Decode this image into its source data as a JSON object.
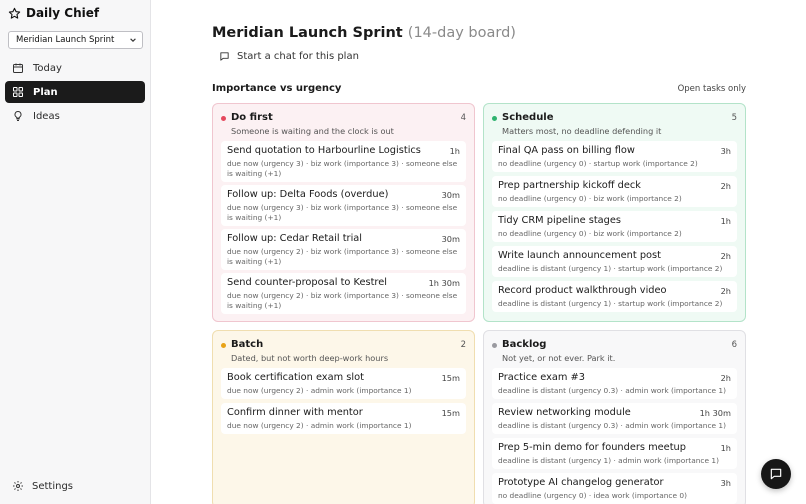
{
  "app": {
    "title": "Daily Chief",
    "accent": "#1b1b1b"
  },
  "board_select": {
    "value": "Meridian Launch Sprint"
  },
  "nav": [
    {
      "label": "Today",
      "icon": "calendar-icon",
      "active": false
    },
    {
      "label": "Plan",
      "icon": "grid-icon",
      "active": true
    },
    {
      "label": "Ideas",
      "icon": "lightbulb-icon",
      "active": false
    }
  ],
  "settings_label": "Settings",
  "header": {
    "title": "Meridian Launch Sprint",
    "subtitle": "(14-day board)",
    "chat_link": "Start a chat for this plan"
  },
  "matrix": {
    "title": "Importance vs urgency",
    "filter": "Open tasks only",
    "quadrants": {
      "do_first": {
        "name": "Do first",
        "count": "4",
        "desc": "Someone is waiting and the clock is out",
        "color": "#e5485d",
        "tasks": [
          {
            "title": "Send quotation to Harbourline Logistics",
            "duration": "1h",
            "meta": "due now (urgency 3) · biz work (importance 3) · someone else is waiting (+1)"
          },
          {
            "title": "Follow up: Delta Foods (overdue)",
            "duration": "30m",
            "meta": "due now (urgency 3) · biz work (importance 3) · someone else is waiting (+1)"
          },
          {
            "title": "Follow up: Cedar Retail trial",
            "duration": "30m",
            "meta": "due now (urgency 2) · biz work (importance 3) · someone else is waiting (+1)"
          },
          {
            "title": "Send counter-proposal to Kestrel",
            "duration": "1h 30m",
            "meta": "due now (urgency 2) · biz work (importance 3) · someone else is waiting (+1)"
          }
        ]
      },
      "schedule": {
        "name": "Schedule",
        "count": "5",
        "desc": "Matters most, no deadline defending it",
        "color": "#2fb36f",
        "tasks": [
          {
            "title": "Final QA pass on billing flow",
            "duration": "3h",
            "meta": "no deadline (urgency 0) · startup work (importance 2)"
          },
          {
            "title": "Prep partnership kickoff deck",
            "duration": "2h",
            "meta": "no deadline (urgency 0) · biz work (importance 2)"
          },
          {
            "title": "Tidy CRM pipeline stages",
            "duration": "1h",
            "meta": "no deadline (urgency 0) · biz work (importance 2)"
          },
          {
            "title": "Write launch announcement post",
            "duration": "2h",
            "meta": "deadline is distant (urgency 1) · startup work (importance 2)"
          },
          {
            "title": "Record product walkthrough video",
            "duration": "2h",
            "meta": "deadline is distant (urgency 1) · startup work (importance 2)"
          }
        ]
      },
      "batch": {
        "name": "Batch",
        "count": "2",
        "desc": "Dated, but not worth deep-work hours",
        "color": "#e8a317",
        "tasks": [
          {
            "title": "Book certification exam slot",
            "duration": "15m",
            "meta": "due now (urgency 2) · admin work (importance 1)"
          },
          {
            "title": "Confirm dinner with mentor",
            "duration": "15m",
            "meta": "due now (urgency 2) · admin work (importance 1)"
          }
        ]
      },
      "backlog": {
        "name": "Backlog",
        "count": "6",
        "desc": "Not yet, or not ever. Park it.",
        "color": "#9a9aa0",
        "tasks": [
          {
            "title": "Practice exam #3",
            "duration": "2h",
            "meta": "deadline is distant (urgency 0.3) · admin work (importance 1)"
          },
          {
            "title": "Review networking module",
            "duration": "1h 30m",
            "meta": "deadline is distant (urgency 0.3) · admin work (importance 1)"
          },
          {
            "title": "Prep 5-min demo for founders meetup",
            "duration": "1h",
            "meta": "deadline is distant (urgency 1) · admin work (importance 1)"
          },
          {
            "title": "Prototype AI changelog generator",
            "duration": "3h",
            "meta": "no deadline (urgency 0) · idea work (importance 0)"
          }
        ]
      }
    }
  },
  "fab": {
    "icon": "chat-bubble-icon"
  }
}
